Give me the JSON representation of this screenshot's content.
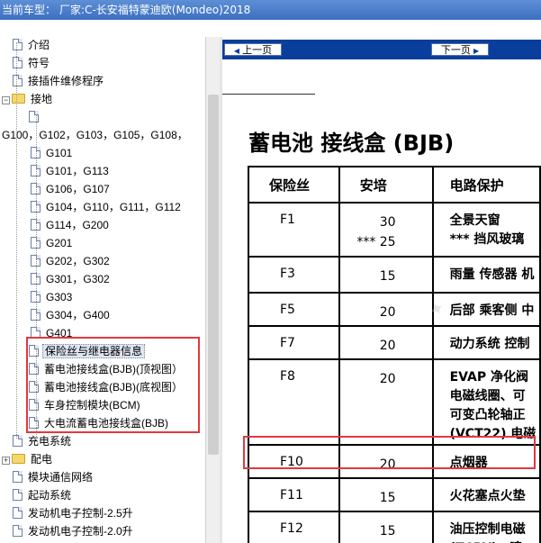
{
  "window": {
    "title_label": "当前车型：",
    "title_value": "厂家:C-长安福特蒙迪欧(Mondeo)2018"
  },
  "tree": {
    "items": [
      {
        "label": "介绍",
        "type": "doc"
      },
      {
        "label": "符号",
        "type": "doc"
      },
      {
        "label": "接插件维修程序",
        "type": "doc"
      },
      {
        "label": "接地",
        "type": "folder-open",
        "expander": "−"
      },
      {
        "label": "",
        "type": "doc"
      },
      {
        "label": "G100，G102，G103，G105，G108，",
        "type": "text"
      },
      {
        "label": "G101",
        "type": "doc"
      },
      {
        "label": "G101，G113",
        "type": "doc"
      },
      {
        "label": "G106，G107",
        "type": "doc"
      },
      {
        "label": "G104，G110，G111，G112",
        "type": "doc"
      },
      {
        "label": "G114，G200",
        "type": "doc"
      },
      {
        "label": "G201",
        "type": "doc"
      },
      {
        "label": "G202，G302",
        "type": "doc"
      },
      {
        "label": "G301，G302",
        "type": "doc"
      },
      {
        "label": "G303",
        "type": "doc"
      },
      {
        "label": "G304，G400",
        "type": "doc"
      },
      {
        "label": "G401",
        "type": "doc"
      },
      {
        "label": "保险丝与继电器信息",
        "type": "doc",
        "selected": true
      },
      {
        "label": "蓄电池接线盒(BJB)(顶视图）",
        "type": "doc"
      },
      {
        "label": "蓄电池接线盒(BJB)(底视图）",
        "type": "doc"
      },
      {
        "label": "车身控制模块(BCM)",
        "type": "doc"
      },
      {
        "label": "大电流蓄电池接线盒(BJB)",
        "type": "doc"
      },
      {
        "label": "充电系统",
        "type": "doc"
      },
      {
        "label": "配电",
        "type": "folder",
        "expander": "+"
      },
      {
        "label": "模块通信网络",
        "type": "doc"
      },
      {
        "label": "起动系统",
        "type": "doc"
      },
      {
        "label": "发动机电子控制-2.5升",
        "type": "doc"
      },
      {
        "label": "发动机电子控制-2.0升",
        "type": "doc"
      }
    ]
  },
  "document": {
    "nav": {
      "prev": "上一页",
      "next": "下一页"
    },
    "title": "蓄电池 接线盒 (BJB)",
    "table": {
      "headers": [
        "保险丝",
        "安培",
        "电路保护"
      ],
      "rows": [
        {
          "fuse": "F1",
          "amps": [
            "30",
            "*** 25"
          ],
          "desc": [
            "全景天窗",
            "***   挡风玻璃"
          ]
        },
        {
          "fuse": "F3",
          "amps": [
            "15"
          ],
          "desc": [
            "雨量 传感器 机"
          ]
        },
        {
          "fuse": "F5",
          "amps": [
            "20"
          ],
          "desc": [
            "后部 乘客侧 中"
          ]
        },
        {
          "fuse": "F7",
          "amps": [
            "20"
          ],
          "desc": [
            "动力系统 控制"
          ]
        },
        {
          "fuse": "F8",
          "amps": [
            "20"
          ],
          "desc": [
            "EVAP 净化阀",
            "电磁线圈、可",
            "可变凸轮轴正",
            "(VCT22) 电磁"
          ]
        },
        {
          "fuse": "F10",
          "amps": [
            "20"
          ],
          "desc": [
            "点烟器"
          ]
        },
        {
          "fuse": "F11",
          "amps": [
            "15"
          ],
          "desc": [
            "火花塞点火垫"
          ]
        },
        {
          "fuse": "F12",
          "amps": [
            "15"
          ],
          "desc": [
            "油压控制电磁",
            "(TCBY)、喷"
          ]
        }
      ]
    }
  },
  "colors": {
    "accent": "#0a3e9c",
    "highlight": "#e0393e",
    "titlebar": "#3b6fc0"
  }
}
